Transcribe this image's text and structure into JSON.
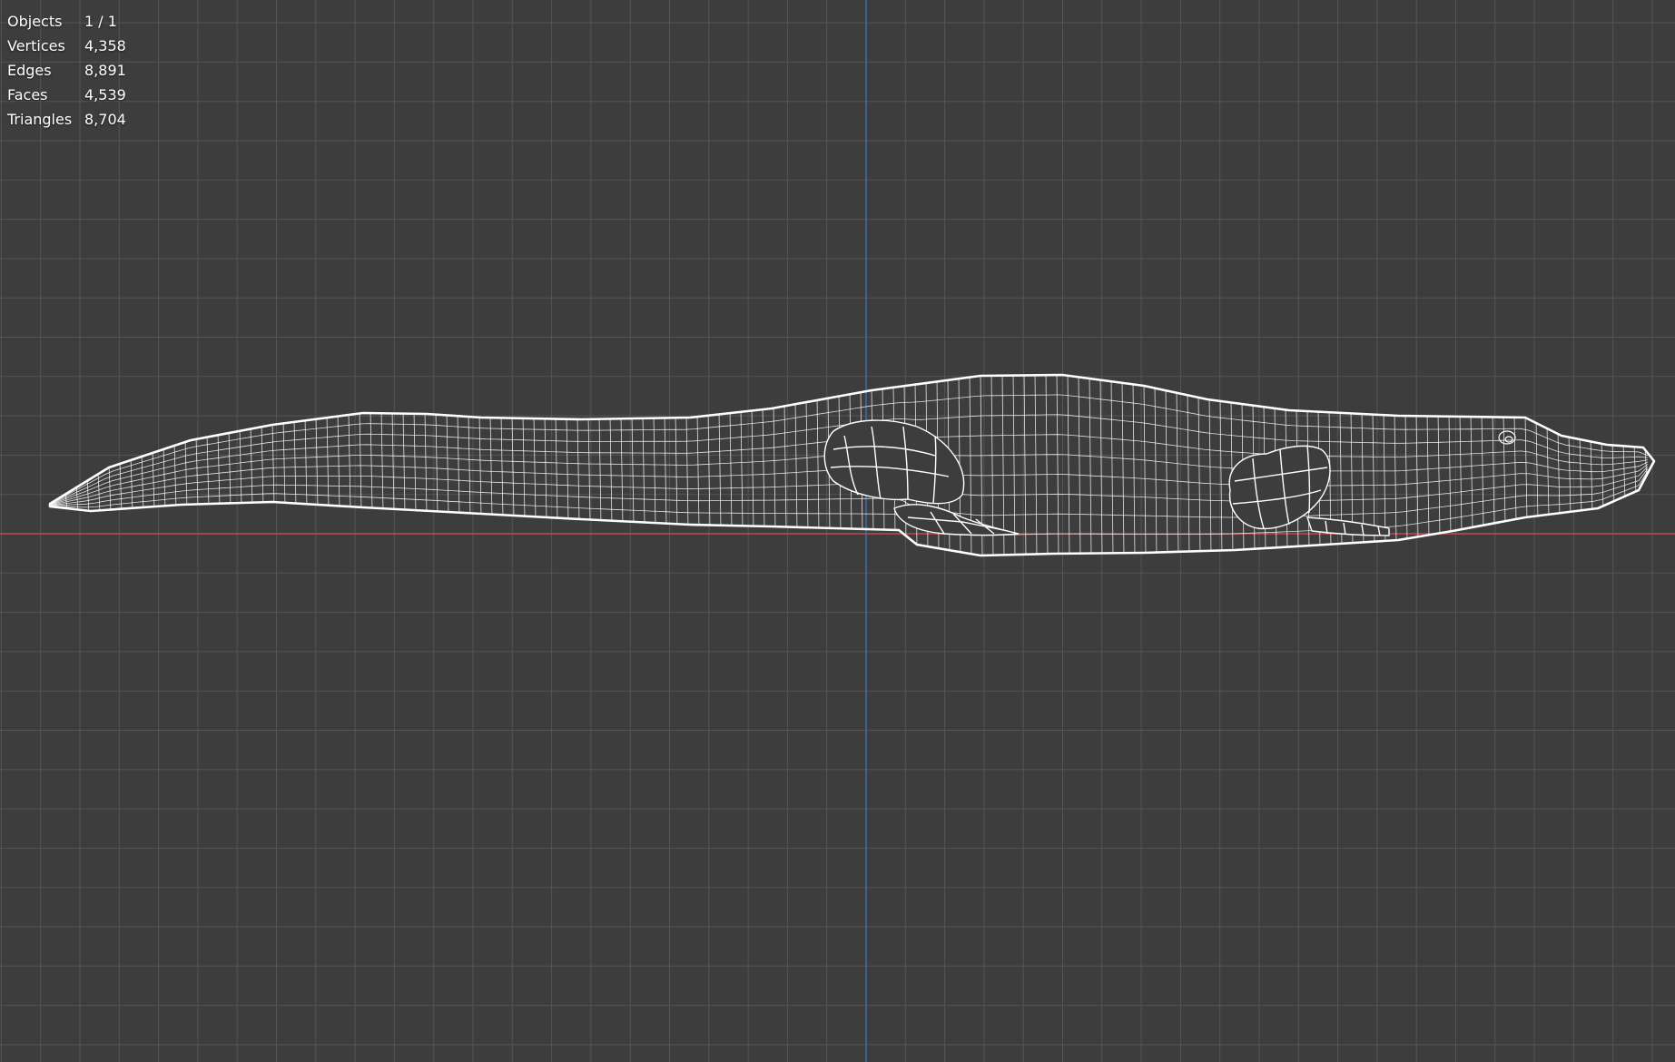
{
  "viewport": {
    "name": "3D Viewport",
    "background": "#3d3d3d",
    "grid_color": "#555555",
    "x_axis_color": "#c24a4a",
    "y_axis_color": "#3f6fb0",
    "wire_color": "#ffffff"
  },
  "statistics": {
    "rows": [
      {
        "label": "Objects",
        "value": "1 / 1"
      },
      {
        "label": "Vertices",
        "value": "4,358"
      },
      {
        "label": "Edges",
        "value": "8,891"
      },
      {
        "label": "Faces",
        "value": "4,539"
      },
      {
        "label": "Triangles",
        "value": "8,704"
      }
    ]
  },
  "object": {
    "display": "wireframe",
    "icon": "mesh-wireframe"
  }
}
